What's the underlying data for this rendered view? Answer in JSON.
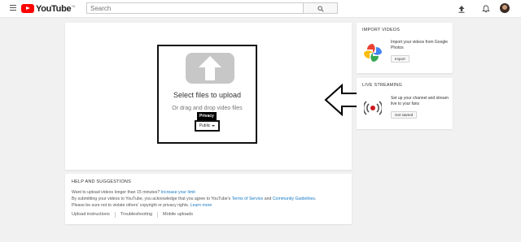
{
  "header": {
    "logo_text": "YouTube",
    "logo_region": "IN",
    "search_placeholder": "Search"
  },
  "upload": {
    "select_files": "Select files to upload",
    "drag_text": "Or drag and drop video files",
    "privacy_tooltip": "Privacy",
    "privacy_value": "Public"
  },
  "help": {
    "title": "HELP AND SUGGESTIONS",
    "line1_text": "Want to upload videos longer than 15 minutes? ",
    "line1_link": "Increase your limit",
    "line2_text": "By submitting your videos to YouTube, you acknowledge that you agree to YouTube's ",
    "line2_link1": "Terms of Service",
    "line2_and": " and ",
    "line2_link2": "Community Guidelines",
    "line2_end": ".",
    "line3_text": "Please be sure not to violate others' copyright or privacy rights. ",
    "line3_link": "Learn more",
    "links": [
      "Upload instructions",
      "Troubleshooting",
      "Mobile uploads"
    ]
  },
  "import_videos": {
    "title": "IMPORT VIDEOS",
    "text": "Import your videos from Google Photos",
    "button": "Import"
  },
  "live_streaming": {
    "title": "LIVE STREAMING",
    "text": "Set up your channel and stream live to your fans",
    "button": "Get started"
  },
  "icons": {
    "menu": "menu-icon",
    "search": "search-icon",
    "upload": "upload-icon",
    "notifications": "bell-icon",
    "apps": "apps-icon",
    "photos": "google-photos-icon",
    "live": "live-stream-icon"
  },
  "colors": {
    "brand": "#ff0000",
    "link": "#167ac6",
    "background": "#f1f1f1"
  }
}
